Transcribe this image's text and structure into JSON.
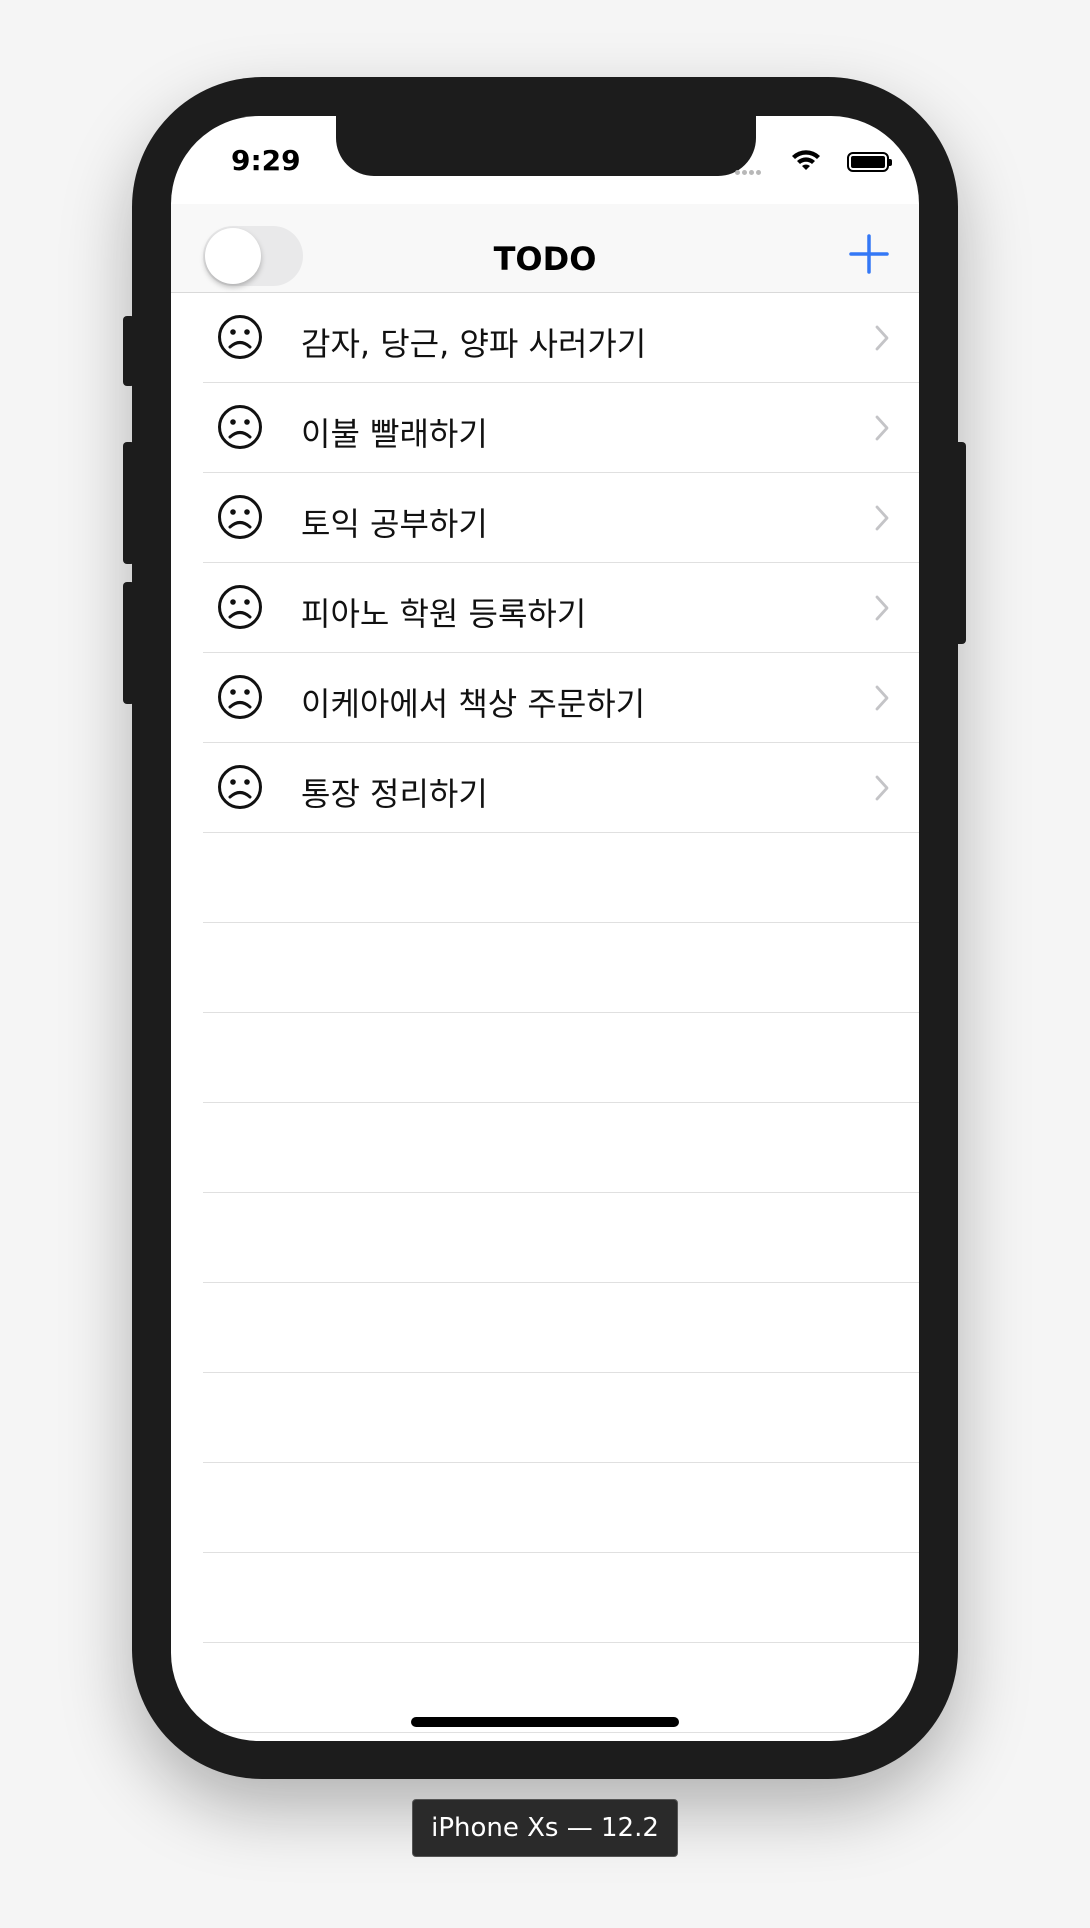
{
  "status_bar": {
    "time": "9:29"
  },
  "navbar": {
    "title": "TODO",
    "toggle_on": false,
    "add_icon": "plus-icon"
  },
  "todos": [
    {
      "label": "감자, 당근, 양파 사러가기",
      "icon": "sad-face-icon"
    },
    {
      "label": "이불 빨래하기",
      "icon": "sad-face-icon"
    },
    {
      "label": "토익 공부하기",
      "icon": "sad-face-icon"
    },
    {
      "label": "피아노 학원 등록하기",
      "icon": "sad-face-icon"
    },
    {
      "label": "이케아에서 책상 주문하기",
      "icon": "sad-face-icon"
    },
    {
      "label": "통장 정리하기",
      "icon": "sad-face-icon"
    }
  ],
  "device": {
    "label": "iPhone Xs — 12.2"
  },
  "colors": {
    "accent": "#3478f6",
    "chevron": "#c4c4c7"
  }
}
